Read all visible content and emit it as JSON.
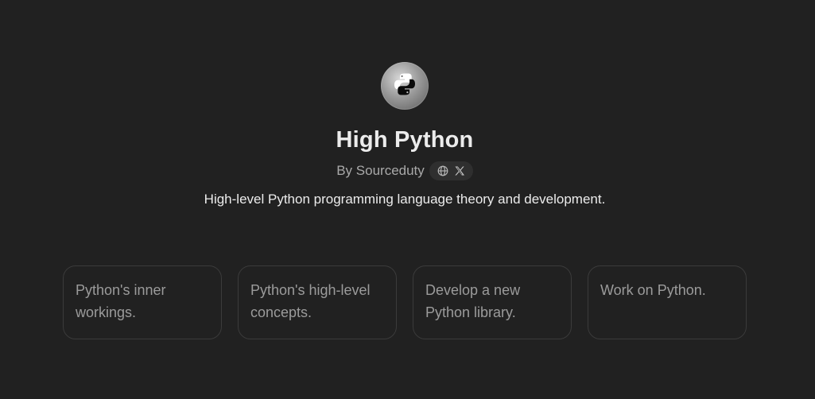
{
  "gpt": {
    "name": "High Python",
    "byline": "By Sourceduty",
    "description": "High-level Python programming language theory and development.",
    "avatar_icon": "python-logo-icon"
  },
  "links": [
    {
      "icon": "globe-icon"
    },
    {
      "icon": "x-logo-icon"
    }
  ],
  "conversation_starters": [
    "Python's inner workings.",
    "Python's high-level concepts.",
    "Develop a new Python library.",
    "Work on Python."
  ],
  "colors": {
    "background": "#212121",
    "title": "#ececec",
    "muted": "#a9a9a9",
    "card_border": "#3b3b3b",
    "card_text": "#9b9b9b"
  }
}
